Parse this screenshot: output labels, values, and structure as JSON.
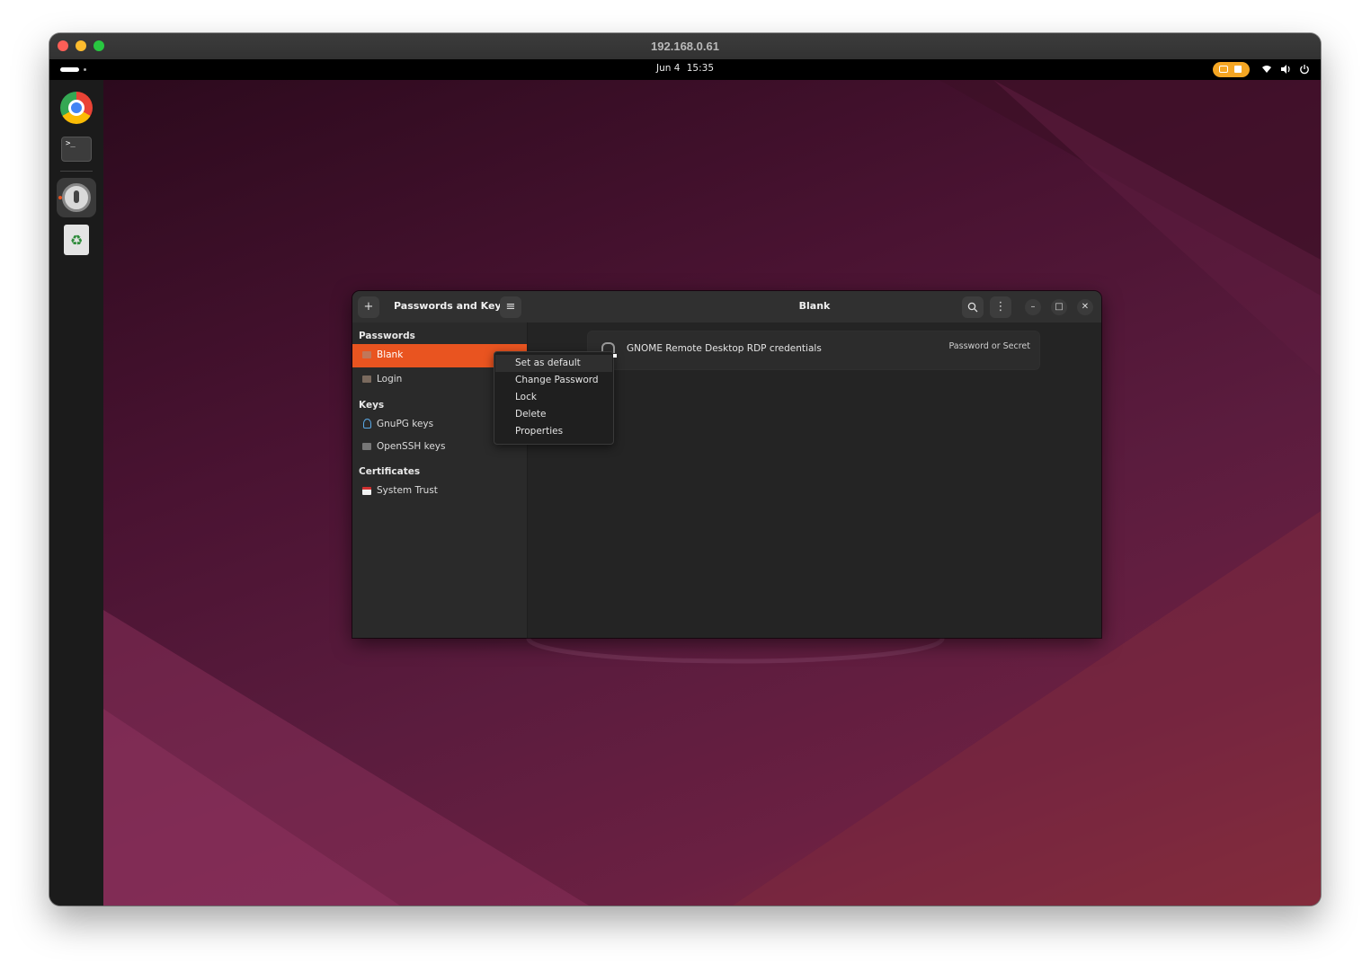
{
  "mac_window": {
    "title": "192.168.0.61"
  },
  "topbar": {
    "date": "Jun 4",
    "time": "15:35",
    "tray_icons": [
      "wifi-icon",
      "volume-icon",
      "power-icon"
    ]
  },
  "dock": {
    "items": [
      "chrome-icon",
      "terminal-icon",
      "passwords-keys-icon",
      "trash-icon"
    ],
    "apps_button": "ubuntu-logo-icon"
  },
  "app": {
    "sidebar_title": "Passwords and Keys",
    "main_title": "Blank",
    "add_button": "+",
    "menu_button": "≡",
    "sidebar": {
      "passwords_heading": "Passwords",
      "passwords": [
        "Blank",
        "Login"
      ],
      "keys_heading": "Keys",
      "keys": [
        "GnuPG keys",
        "OpenSSH keys"
      ],
      "certificates_heading": "Certificates",
      "certificates": [
        "System Trust"
      ]
    },
    "items": [
      {
        "name": "GNOME Remote Desktop RDP credentials",
        "type": "Password or Secret"
      }
    ]
  },
  "context_menu": {
    "items": [
      "Set as default",
      "Change Password",
      "Lock",
      "Delete",
      "Properties"
    ]
  },
  "colors": {
    "accent": "#e95420",
    "indicator": "#f5a623"
  }
}
